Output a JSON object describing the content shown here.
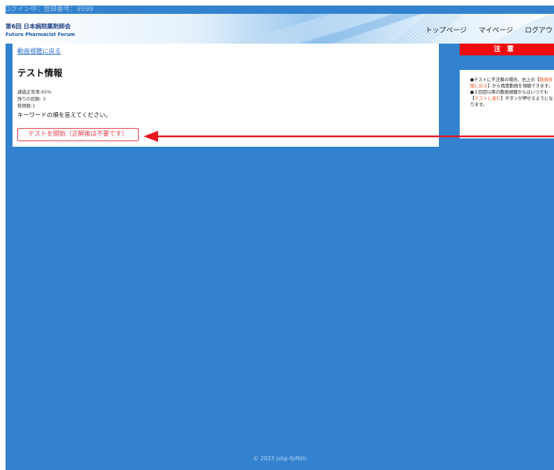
{
  "login_bar": {
    "text": "ログイン中：登録番号：9999"
  },
  "header": {
    "logo_jp": "第6回 日本病院薬剤師会",
    "logo_en": "Future Pharmacist Forum",
    "nav": [
      "トップページ",
      "マイページ",
      "ログアウト"
    ]
  },
  "main": {
    "back_link": "動画視聴に戻る",
    "heading": "テスト情報",
    "stats": [
      "通過正答率:65%",
      "残りの回数: 3",
      "質問数:1"
    ],
    "instruction": "キーワードの順を答えてください。",
    "start_button": "テストを開始（正解後は不要です）"
  },
  "notice": {
    "title": "注意",
    "bullet1_a": "●テストに不正解の場合、右上の【",
    "bullet1_hl": "動画視聴に戻る",
    "bullet1_b": "】から再度動画を視聴できます。",
    "bullet2_a": "●２回目以降の動画視聴からはいつでも【",
    "bullet2_hl": "テストに進む",
    "bullet2_b": "】ボタンが押せるようになります。"
  },
  "annotation": {
    "arrow_color": "#e5171f"
  },
  "footer": {
    "copyright": "© 2023 jshp-fpf6th"
  }
}
